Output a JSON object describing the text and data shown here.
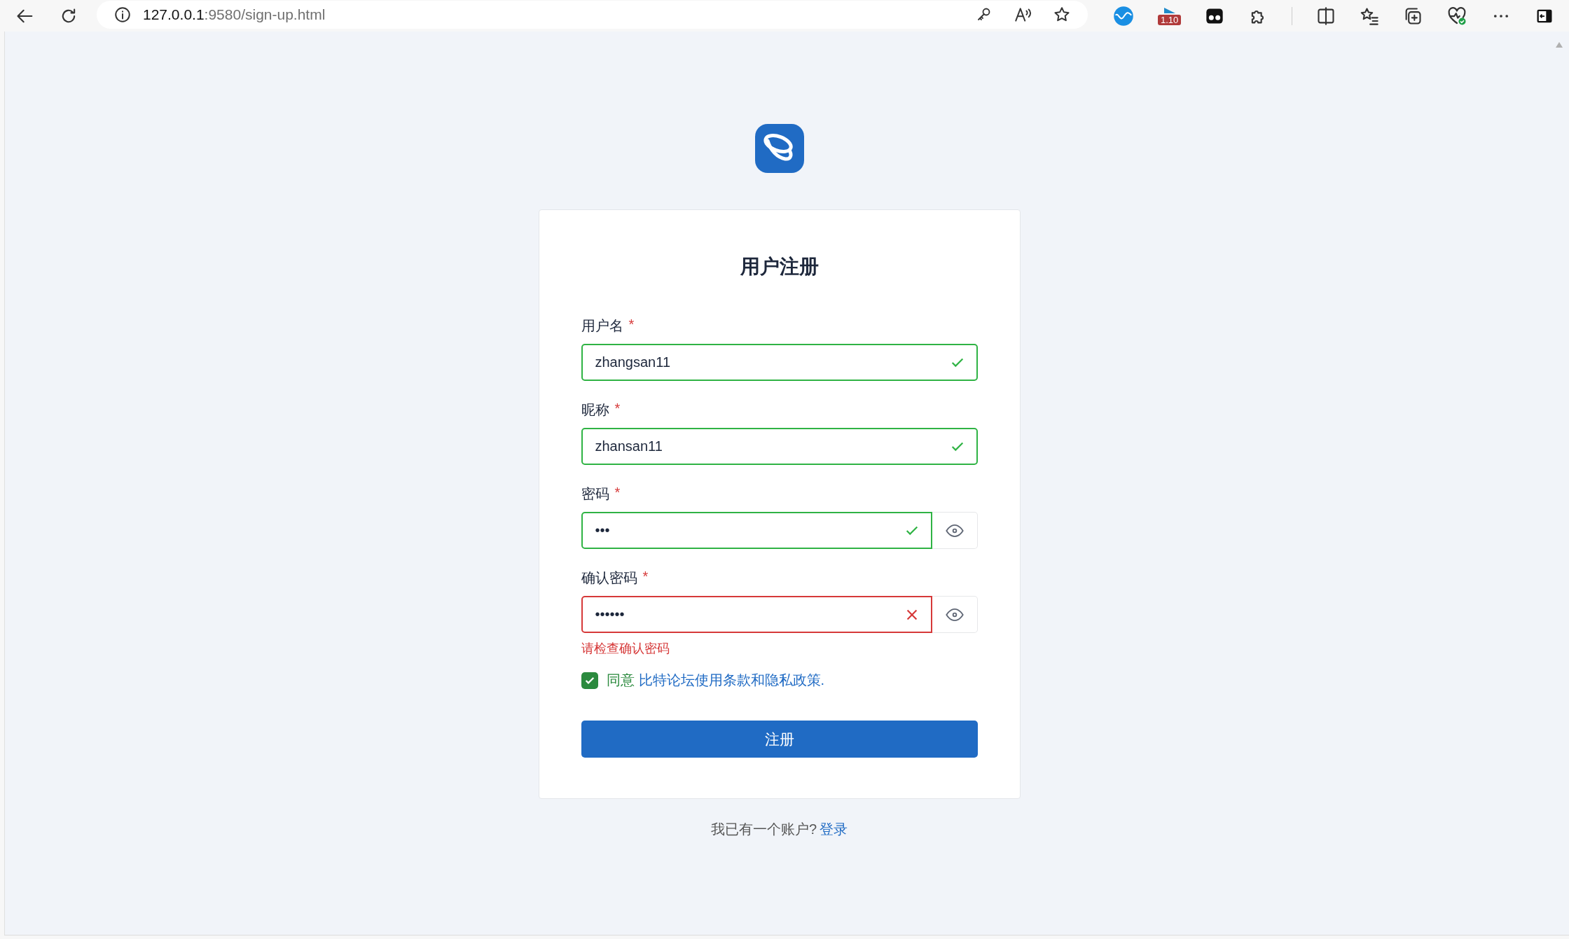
{
  "browser": {
    "url_host": "127.0.0.1",
    "url_path": ":9580/sign-up.html",
    "extension_badge": "1.10"
  },
  "card": {
    "title": "用户注册",
    "fields": [
      {
        "label": "用户名",
        "required_mark": "*",
        "value": "zhangsan11",
        "valid": true,
        "reveal_toggle": false
      },
      {
        "label": "昵称",
        "required_mark": "*",
        "value": "zhansan11",
        "valid": true,
        "reveal_toggle": false
      },
      {
        "label": "密码",
        "required_mark": "*",
        "value": "•••",
        "valid": true,
        "reveal_toggle": true
      },
      {
        "label": "确认密码",
        "required_mark": "*",
        "value": "••••••",
        "valid": false,
        "reveal_toggle": true,
        "error": "请检查确认密码"
      }
    ],
    "agreement": {
      "checked": true,
      "prefix": "同意",
      "link": "比特论坛使用条款和隐私政策."
    },
    "submit": "注册"
  },
  "footer": {
    "text": "我已有一个账户?",
    "link": "登录"
  }
}
